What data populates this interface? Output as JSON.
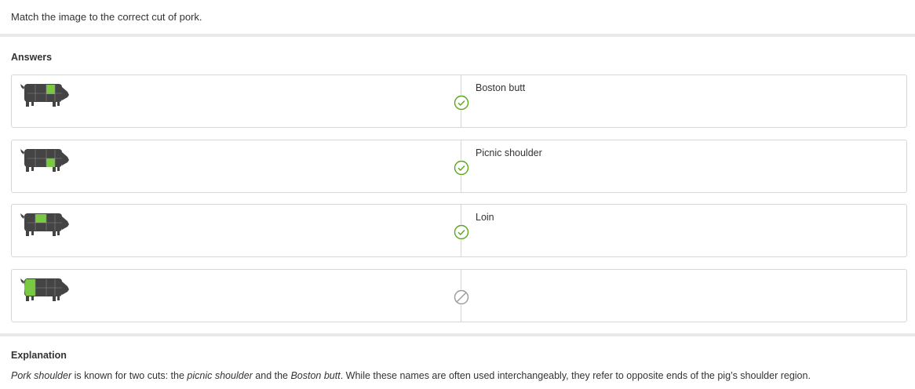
{
  "question": "Match the image to the correct cut of pork.",
  "answers_heading": "Answers",
  "answers": [
    {
      "image": "pig-diagram-boston-butt-highlight",
      "label": "Boston butt",
      "status": "correct"
    },
    {
      "image": "pig-diagram-picnic-shoulder-highlight",
      "label": "Picnic shoulder",
      "status": "correct"
    },
    {
      "image": "pig-diagram-loin-highlight",
      "label": "Loin",
      "status": "correct"
    },
    {
      "image": "pig-diagram-ham-highlight",
      "label": "",
      "status": "unanswered"
    }
  ],
  "explanation": {
    "heading": "Explanation",
    "em1": "Pork shoulder",
    "t1": " is known for two cuts: the ",
    "em2": "picnic shoulder",
    "t2": " and the ",
    "em3": "Boston butt",
    "t3": ". While these names are often used interchangeably, they refer to opposite ends of the pig’s shoulder region."
  },
  "colors": {
    "highlight": "#7ac943",
    "pig": "#444444",
    "correct": "#5aa51d",
    "unanswered": "#999999"
  }
}
